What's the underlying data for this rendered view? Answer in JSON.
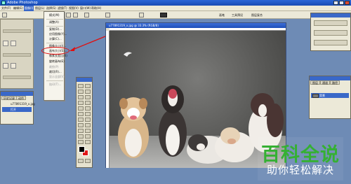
{
  "window": {
    "title": "Adobe Photoshop"
  },
  "menubar": {
    "items": [
      {
        "label": "文件(F)"
      },
      {
        "label": "编辑(E)"
      },
      {
        "label": "图像(I)"
      },
      {
        "label": "图层(L)"
      },
      {
        "label": "选择(S)"
      },
      {
        "label": "滤镜(T)"
      },
      {
        "label": "视图(V)"
      },
      {
        "label": "窗口(W)"
      },
      {
        "label": "帮助(H)"
      }
    ]
  },
  "options": {
    "right_labels": [
      "画笔",
      "工具预设",
      "图层复合"
    ]
  },
  "dropdown": {
    "items": [
      {
        "label": "模式(M)"
      },
      {
        "label": "调整(A)"
      },
      {
        "label": "复制(D)..."
      },
      {
        "label": "应用图像(Y)..."
      },
      {
        "label": "计算(C)..."
      },
      {
        "label": "图像大小(I)..."
      },
      {
        "label": "画布大小(S)..."
      },
      {
        "label": "像素长宽比(X)"
      },
      {
        "label": "旋转画布(E)"
      },
      {
        "label": "裁剪(P)"
      },
      {
        "label": "裁切(R)..."
      },
      {
        "label": "显示全部(V)"
      },
      {
        "label": "陷印(T)..."
      }
    ],
    "highlighted": "旋转画布(E)"
  },
  "document": {
    "title": "u77891319_x.jpg @ 33.3% (RGB/8)"
  },
  "history_panel": {
    "tabs": [
      "历史记录",
      "动作"
    ],
    "rows": [
      "u77891319_x.jpg",
      "打开"
    ]
  },
  "layers_panel": {
    "tabs": [
      "图层",
      "通道",
      "路径"
    ],
    "layer_name": "背景"
  },
  "watermark": {
    "title": "百科全说",
    "subtitle": "助你轻松解决"
  },
  "colors": {
    "accent": "#3a68c8",
    "annotation": "#e01010",
    "watermark_green": "#35b033"
  }
}
